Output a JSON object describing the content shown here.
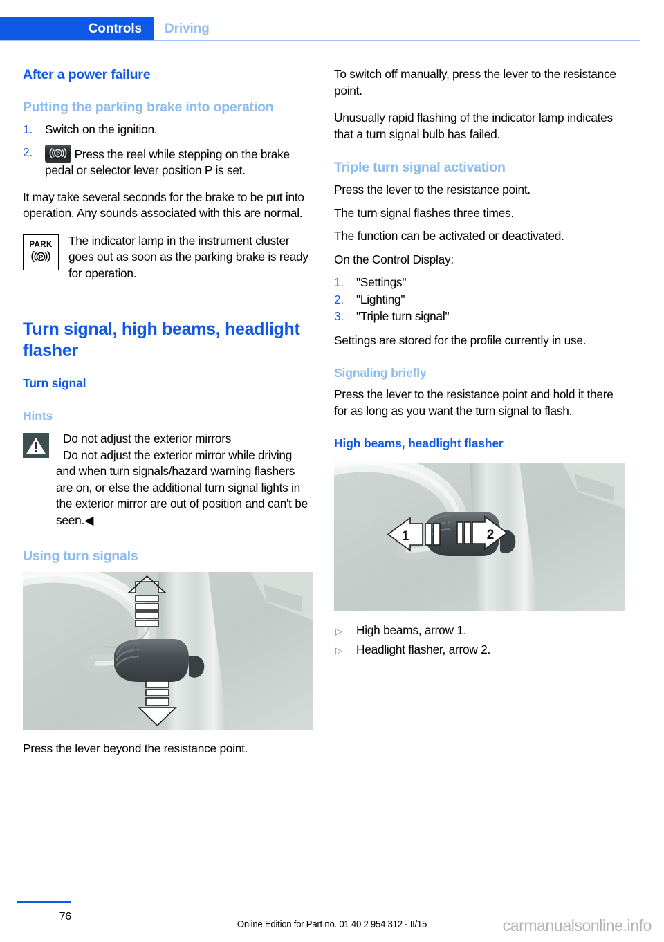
{
  "header": {
    "active_tab": "Controls",
    "inactive_tab": "Driving"
  },
  "colors": {
    "accent_blue": "#1059e8",
    "light_blue": "#8cbcf0",
    "rule_blue": "#9dc2f0",
    "bullet_blue": "#4d93ef"
  },
  "left_column": {
    "heading_power_failure": "After a power failure",
    "heading_parking_brake": "Putting the parking brake into operation",
    "steps": [
      {
        "num": "1.",
        "text": "Switch on the ignition."
      },
      {
        "num": "2.",
        "text": "Press the reel while stepping on the brake pedal or selector lever position P is set.",
        "has_icon": true,
        "icon": "parking-brake-button-icon"
      }
    ],
    "paragraph_seconds": "It may take several seconds for the brake to be put into operation. Any sounds associated with this are normal.",
    "park_indicator": {
      "icon_label": "PARK",
      "icon_symbol": "((P))",
      "text": "The indicator lamp in the instrument cluster goes out as soon as the parking brake is ready for operation."
    },
    "heading_turn_signal_main": "Turn signal, high beams, headlight flasher",
    "heading_turn_signal": "Turn signal",
    "heading_hints": "Hints",
    "warning": {
      "title": "Do not adjust the exterior mirrors",
      "body": "Do not adjust the exterior mirror while driving and when turn signals/hazard warning flashers are on, or else the additional turn signal lights in the exterior mirror are out of position and can't be seen.◀"
    },
    "heading_using_turn_signals": "Using turn signals",
    "figure_turn_signal_caption": "Press the lever beyond the resistance point."
  },
  "right_column": {
    "paragraph_switch_off": "To switch off manually, press the lever to the resistance point.",
    "paragraph_rapid_flashing": "Unusually rapid flashing of the indicator lamp indicates that a turn signal bulb has failed.",
    "heading_triple_turn": "Triple turn signal activation",
    "paragraph_press_lever": "Press the lever to the resistance point.",
    "paragraph_flashes_three": "The turn signal flashes three times.",
    "paragraph_function_activated": "The function can be activated or deactivated.",
    "paragraph_control_display": "On the Control Display:",
    "steps": [
      {
        "num": "1.",
        "text": "\"Settings\""
      },
      {
        "num": "2.",
        "text": "\"Lighting\""
      },
      {
        "num": "3.",
        "text": "\"Triple turn signal\""
      }
    ],
    "paragraph_settings_stored": "Settings are stored for the profile currently in use.",
    "heading_signaling_briefly": "Signaling briefly",
    "paragraph_signaling_briefly": "Press the lever to the resistance point and hold it there for as long as you want the turn signal to flash.",
    "heading_high_beams": "High beams, headlight flasher",
    "bullets": [
      {
        "marker": "▷",
        "text": "High beams, arrow 1."
      },
      {
        "marker": "▷",
        "text": "Headlight flasher, arrow 2."
      }
    ],
    "figure_labels": {
      "arrow_1": "1",
      "arrow_2": "2"
    }
  },
  "footer": {
    "page_number": "76",
    "edition": "Online Edition for Part no. 01 40 2 954 312 - II/15",
    "watermark": "carmanualsonline.info"
  }
}
